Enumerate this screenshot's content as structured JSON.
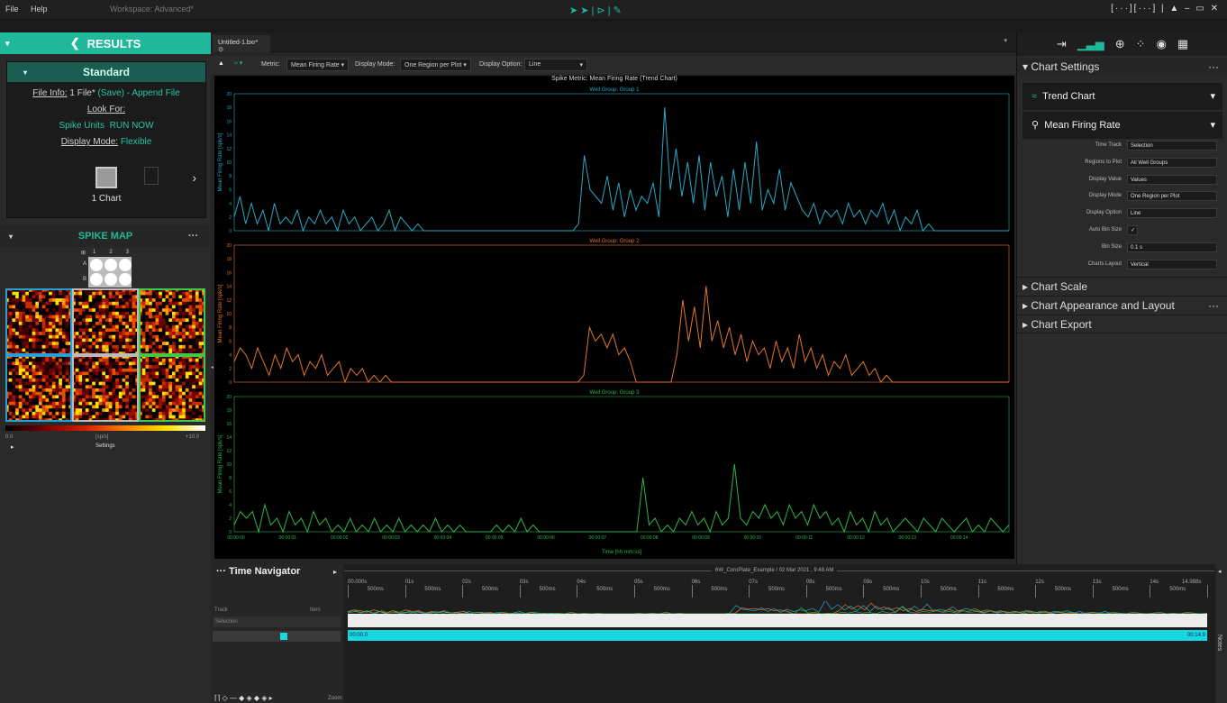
{
  "menu": {
    "file": "File",
    "help": "Help",
    "workspace": "Workspace: Advanced*",
    "right_cluster": "[···][···] | ▲ – ▭ ✕"
  },
  "left": {
    "results_title": "RESULTS",
    "standard_title": "Standard",
    "file_info_label": "File Info:",
    "file_info_value": "1 File*",
    "save": "(Save)",
    "append": "- Append File",
    "look_for": "Look For:",
    "spike_units": "Spike Units",
    "run_now": "RUN NOW",
    "display_mode_label": "Display Mode:",
    "display_mode_value": "Flexible",
    "chart_count": "1 Chart",
    "spike_map_title": "SPIKE MAP",
    "map_cols": [
      "1",
      "2",
      "3"
    ],
    "map_rows": [
      "A",
      "B"
    ],
    "scale_min": "0.0",
    "scale_unit": "[sp/s]",
    "scale_max": "+10.0",
    "settings": "Settings"
  },
  "tab": {
    "label": "Untitled-1.bxr*"
  },
  "ctoolbar": {
    "metric_label": "Metric:",
    "metric": "Mean Firing Rate",
    "display_mode_label": "Display Mode:",
    "display_mode": "One Region per Plot",
    "display_option_label": "Display Option:",
    "display_option": "Line"
  },
  "chart_data": [
    {
      "type": "line",
      "title": "Spike Metric: Mean Firing Rate (Trend Chart)",
      "subtitle": "Well Group: Group 1",
      "ylabel": "Mean Firing Rate [spk/s]",
      "ylim": [
        0,
        20
      ],
      "yticks": [
        "20",
        "18",
        "16",
        "14",
        "12",
        "10",
        "8",
        "6",
        "4",
        "2",
        "0"
      ],
      "color": "#2aa9c6",
      "values": [
        2,
        5,
        1,
        4,
        1,
        3,
        0,
        4,
        1,
        2,
        1,
        3,
        0,
        2,
        1,
        3,
        1,
        2,
        0,
        3,
        1,
        2,
        0,
        1,
        2,
        0,
        1,
        3,
        0,
        2,
        1,
        0,
        1,
        0,
        0,
        0,
        0,
        0,
        0,
        0,
        0,
        0,
        0,
        0,
        0,
        0,
        0,
        0,
        0,
        0,
        0,
        0,
        0,
        0,
        0,
        0,
        0,
        0,
        0,
        0,
        1,
        11,
        6,
        5,
        4,
        8,
        3,
        7,
        2,
        6,
        3,
        5,
        4,
        7,
        2,
        18,
        6,
        12,
        5,
        10,
        4,
        11,
        3,
        10,
        5,
        8,
        2,
        9,
        3,
        10,
        4,
        13,
        3,
        6,
        4,
        9,
        3,
        7,
        5,
        3,
        2,
        4,
        1,
        3,
        2,
        3,
        1,
        4,
        2,
        3,
        1,
        3,
        2,
        4,
        1,
        3,
        0,
        2,
        1,
        3,
        0,
        1,
        0,
        0,
        0,
        0,
        0,
        0,
        0,
        0,
        0,
        0,
        0,
        0,
        0,
        0
      ]
    },
    {
      "type": "line",
      "subtitle": "Well Group: Group 2",
      "ylabel": "Mean Firing Rate [spk/s]",
      "ylim": [
        0,
        20
      ],
      "yticks": [
        "20",
        "18",
        "16",
        "14",
        "12",
        "10",
        "8",
        "6",
        "4",
        "2",
        "0"
      ],
      "color": "#e4752b",
      "values": [
        3,
        5,
        4,
        2,
        5,
        3,
        1,
        4,
        2,
        5,
        3,
        4,
        1,
        3,
        2,
        4,
        1,
        2,
        3,
        0,
        2,
        1,
        2,
        0,
        1,
        0,
        1,
        0,
        0,
        0,
        0,
        0,
        0,
        0,
        0,
        0,
        0,
        0,
        0,
        0,
        0,
        0,
        0,
        0,
        0,
        0,
        0,
        0,
        0,
        0,
        0,
        0,
        0,
        0,
        0,
        0,
        0,
        0,
        0,
        0,
        1,
        8,
        6,
        7,
        5,
        7,
        4,
        5,
        3,
        0,
        0,
        0,
        0,
        0,
        0,
        0,
        4,
        12,
        6,
        11,
        5,
        14,
        6,
        9,
        5,
        8,
        4,
        7,
        3,
        6,
        4,
        5,
        2,
        6,
        3,
        5,
        2,
        7,
        3,
        5,
        2,
        4,
        1,
        3,
        2,
        4,
        1,
        2,
        3,
        1,
        2,
        0,
        1,
        0,
        0,
        0,
        0,
        0,
        0,
        0,
        0,
        0,
        0,
        0,
        0,
        0,
        0,
        0,
        0,
        0,
        0,
        0,
        0,
        0
      ]
    },
    {
      "type": "line",
      "subtitle": "Well Group: Group 3",
      "ylabel": "Mean Firing Rate [spk/s]",
      "ylim": [
        0,
        20
      ],
      "yticks": [
        "20",
        "18",
        "16",
        "14",
        "12",
        "10",
        "8",
        "6",
        "4",
        "2",
        "0"
      ],
      "color": "#2fb54a",
      "xlabel": "Time [hh:mm:ss]",
      "xticks": [
        "00:00:00",
        "00:00:01",
        "00:00:02",
        "00:00:03",
        "00:00:04",
        "00:00:05",
        "00:00:06",
        "00:00:07",
        "00:00:08",
        "00:00:09",
        "00:00:10",
        "00:00:11",
        "00:00:12",
        "00:00:13",
        "00:00:14"
      ],
      "values": [
        1,
        3,
        2,
        3,
        0,
        4,
        1,
        2,
        0,
        3,
        1,
        2,
        0,
        3,
        1,
        2,
        0,
        1,
        0,
        2,
        0,
        1,
        0,
        2,
        0,
        1,
        0,
        2,
        0,
        1,
        0,
        1,
        0,
        2,
        0,
        1,
        0,
        1,
        0,
        0,
        0,
        0,
        0,
        1,
        0,
        1,
        0,
        2,
        0,
        1,
        0,
        0,
        0,
        0,
        0,
        0,
        0,
        0,
        0,
        0,
        0,
        0,
        0,
        0,
        0,
        0,
        0,
        8,
        1,
        2,
        0,
        1,
        0,
        2,
        1,
        3,
        1,
        2,
        0,
        3,
        1,
        2,
        10,
        2,
        1,
        3,
        2,
        4,
        2,
        3,
        1,
        4,
        2,
        3,
        1,
        4,
        2,
        3,
        1,
        2,
        0,
        3,
        1,
        2,
        0,
        3,
        1,
        2,
        0,
        1,
        2,
        1,
        0,
        2,
        1,
        0,
        2,
        1,
        0,
        1,
        2,
        0,
        1,
        0,
        2,
        1,
        0,
        1
      ]
    }
  ],
  "right": {
    "chart_settings": "Chart Settings",
    "trend_chart": "Trend Chart",
    "mfr": "Mean Firing Rate",
    "rows": [
      {
        "label": "Time Track",
        "value": "Selection"
      },
      {
        "label": "Regions to Plot",
        "value": "All Well Groups"
      },
      {
        "label": "Display Value",
        "value": "Values"
      },
      {
        "label": "Display Mode",
        "value": "One Region per Plot"
      },
      {
        "label": "Display Option",
        "value": "Line"
      },
      {
        "label": "Auto Bin Size",
        "value": "✓"
      },
      {
        "label": "Bin Size",
        "value": "0.1 s"
      },
      {
        "label": "Charts Layout",
        "value": "Vertical"
      }
    ],
    "chart_scale": "Chart Scale",
    "chart_appearance": "Chart Appearance and Layout",
    "chart_export": "Chart Export"
  },
  "tn": {
    "title": "Time Navigator",
    "file_caption": "6W_CoroPlate_Example / 02 Mar 2021 , 9:48 AM",
    "track": "Track",
    "item": "Item",
    "selection": "Selection",
    "start": "00:00.0",
    "end": "00:14.9",
    "range_left": "00.000s",
    "range_right": "14.988s",
    "sec_labels": [
      "01s",
      "02s",
      "03s",
      "04s",
      "05s",
      "06s",
      "07s",
      "08s",
      "09s",
      "10s",
      "11s",
      "12s",
      "13s",
      "14s"
    ],
    "ms_label": "500ms",
    "zoom": "Zoom:",
    "notes": "Notes"
  }
}
